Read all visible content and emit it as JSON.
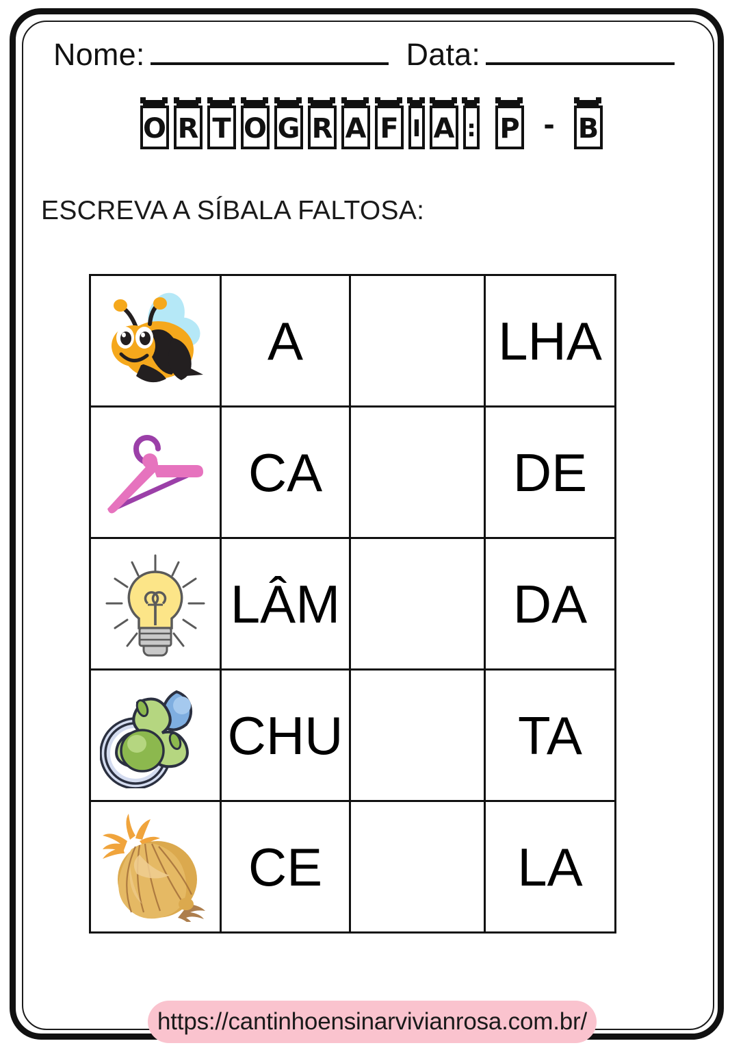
{
  "header": {
    "name_label": "Nome:",
    "date_label": "Data:"
  },
  "title": {
    "text": "ORTOGRAFIA: P - B",
    "letters": [
      "O",
      "R",
      "T",
      "O",
      "G",
      "R",
      "A",
      "F",
      "I",
      "A",
      ":",
      " ",
      "P",
      " ",
      "-",
      " ",
      "B"
    ]
  },
  "instruction": {
    "text": "ESCREVA A SÍBALA FALTOSA:"
  },
  "table": {
    "rows": [
      {
        "image": "bee-icon",
        "image_label": "bee",
        "word": "ABELHA",
        "first": "A",
        "missing": "",
        "last": "LHA"
      },
      {
        "image": "clothes-hanger-icon",
        "image_label": "clothes hanger",
        "word": "CABIDE",
        "first": "CA",
        "missing": "",
        "last": "DE"
      },
      {
        "image": "light-bulb-icon",
        "image_label": "light bulb",
        "word": "LÂMPADA",
        "first": "LÂM",
        "missing": "",
        "last": "DA"
      },
      {
        "image": "pacifier-icon",
        "image_label": "pacifier",
        "word": "CHUPETA",
        "first": "CHU",
        "missing": "",
        "last": "TA"
      },
      {
        "image": "onion-icon",
        "image_label": "onion",
        "word": "CEBOLA",
        "first": "CE",
        "missing": "",
        "last": "LA"
      }
    ]
  },
  "footer": {
    "url": "https://cantinhoensinarvivianrosa.com.br/",
    "badge_color": "#FAC3CE"
  },
  "colors": {
    "ink": "#111111",
    "bee_body": "#F5A81C",
    "bee_stripe": "#231F20",
    "bee_wing": "#B5E8F7",
    "hanger_pink": "#E673BE",
    "hanger_purple": "#9B3FA8",
    "bulb_yellow": "#FCE588",
    "bulb_outline": "#5A5A5A",
    "bulb_base": "#C9C9C9",
    "pacifier_green": "#B5D680",
    "pacifier_green_dark": "#8CB84E",
    "pacifier_blue": "#7FAEE0",
    "pacifier_ring": "#D4DCF0",
    "pacifier_outline": "#2B3040",
    "onion_body": "#DBA94E",
    "onion_line": "#A4703A",
    "onion_sprout": "#F0A43C"
  }
}
